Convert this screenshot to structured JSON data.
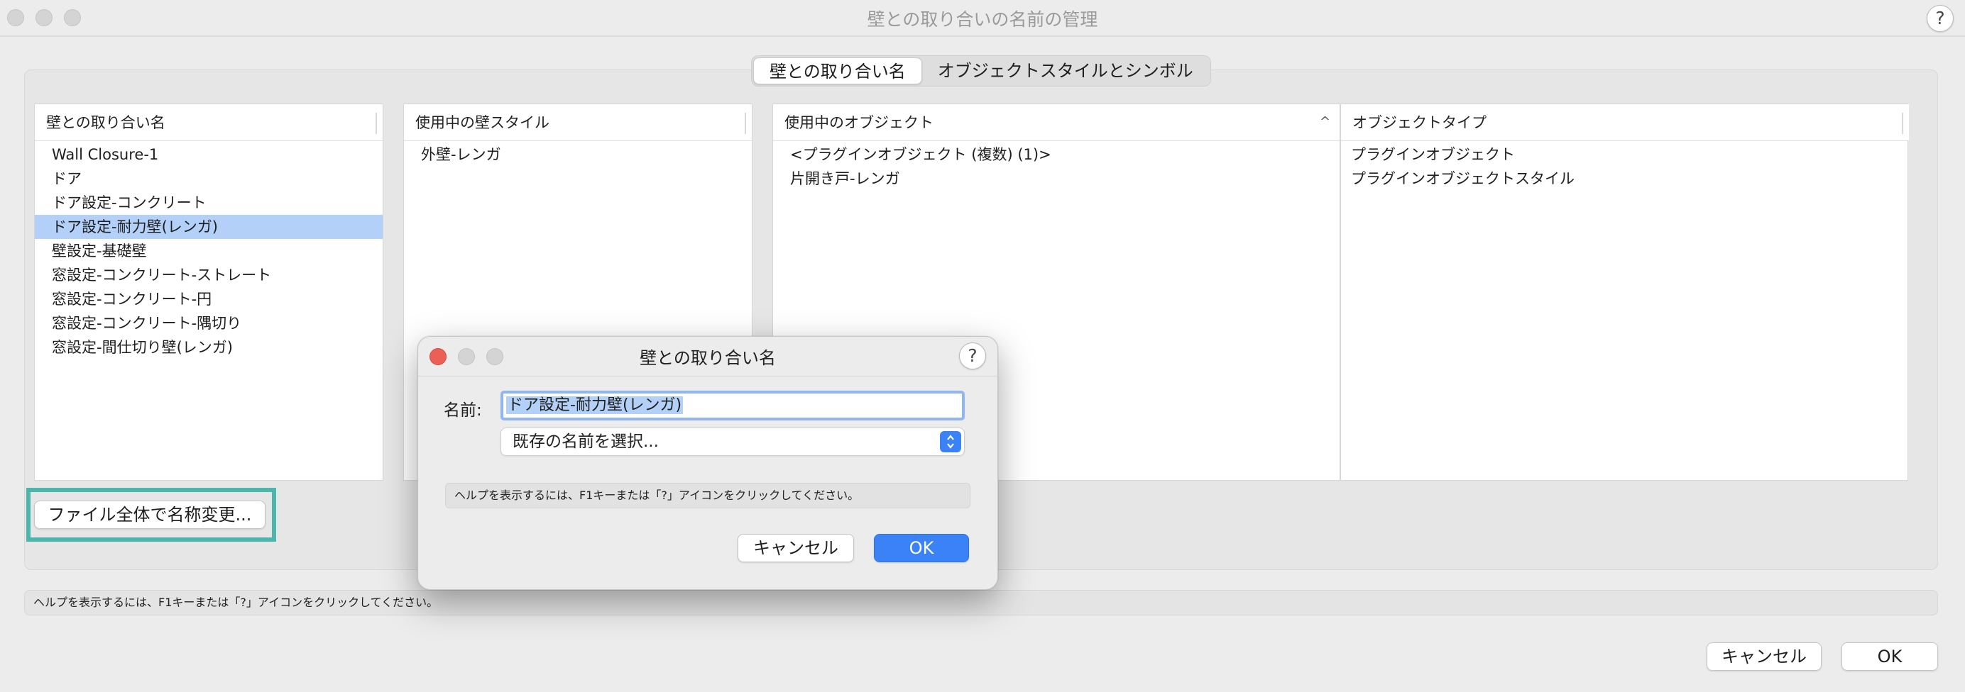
{
  "window": {
    "title": "壁との取り合いの名前の管理",
    "help": "?"
  },
  "tabs": [
    {
      "label": "壁との取り合い名",
      "active": true
    },
    {
      "label": "オブジェクトスタイルとシンボル",
      "active": false
    }
  ],
  "closure_list": {
    "header": "壁との取り合い名",
    "items": [
      "Wall Closure-1",
      "ドア",
      "ドア設定-コンクリート",
      "ドア設定-耐力壁(レンガ)",
      "壁設定-基礎壁",
      "窓設定-コンクリート-ストレート",
      "窓設定-コンクリート-円",
      "窓設定-コンクリート-隅切り",
      "窓設定-間仕切り壁(レンガ)"
    ],
    "selected_index": 3
  },
  "wall_styles": {
    "header": "使用中の壁スタイル",
    "items": [
      "外壁-レンガ"
    ]
  },
  "objects_table": {
    "headers": [
      "使用中のオブジェクト",
      "オブジェクトタイプ"
    ],
    "sort_icon": "^",
    "rows": [
      [
        "<プラグインオブジェクト (複数) (1)>",
        "プラグインオブジェクト"
      ],
      [
        "片開き戸-レンガ",
        "プラグインオブジェクトスタイル"
      ]
    ]
  },
  "rename_button": "ファイル全体で名称変更...",
  "status_text": "ヘルプを表示するには、F1キーまたは「?」アイコンをクリックしてください。",
  "footer": {
    "cancel": "キャンセル",
    "ok": "OK"
  },
  "dialog": {
    "title": "壁との取り合い名",
    "help": "?",
    "name_label": "名前:",
    "name_value": "ドア設定-耐力壁(レンガ)",
    "select_value": "既存の名前を選択...",
    "help_text": "ヘルプを表示するには、F1キーまたは「?」アイコンをクリックしてください。",
    "cancel": "キャンセル",
    "ok": "OK"
  },
  "colors": {
    "selection": "#b3d1f8",
    "accent": "#3b82f6",
    "highlight_box": "#4db6ac",
    "close_red": "#ec5f57"
  }
}
